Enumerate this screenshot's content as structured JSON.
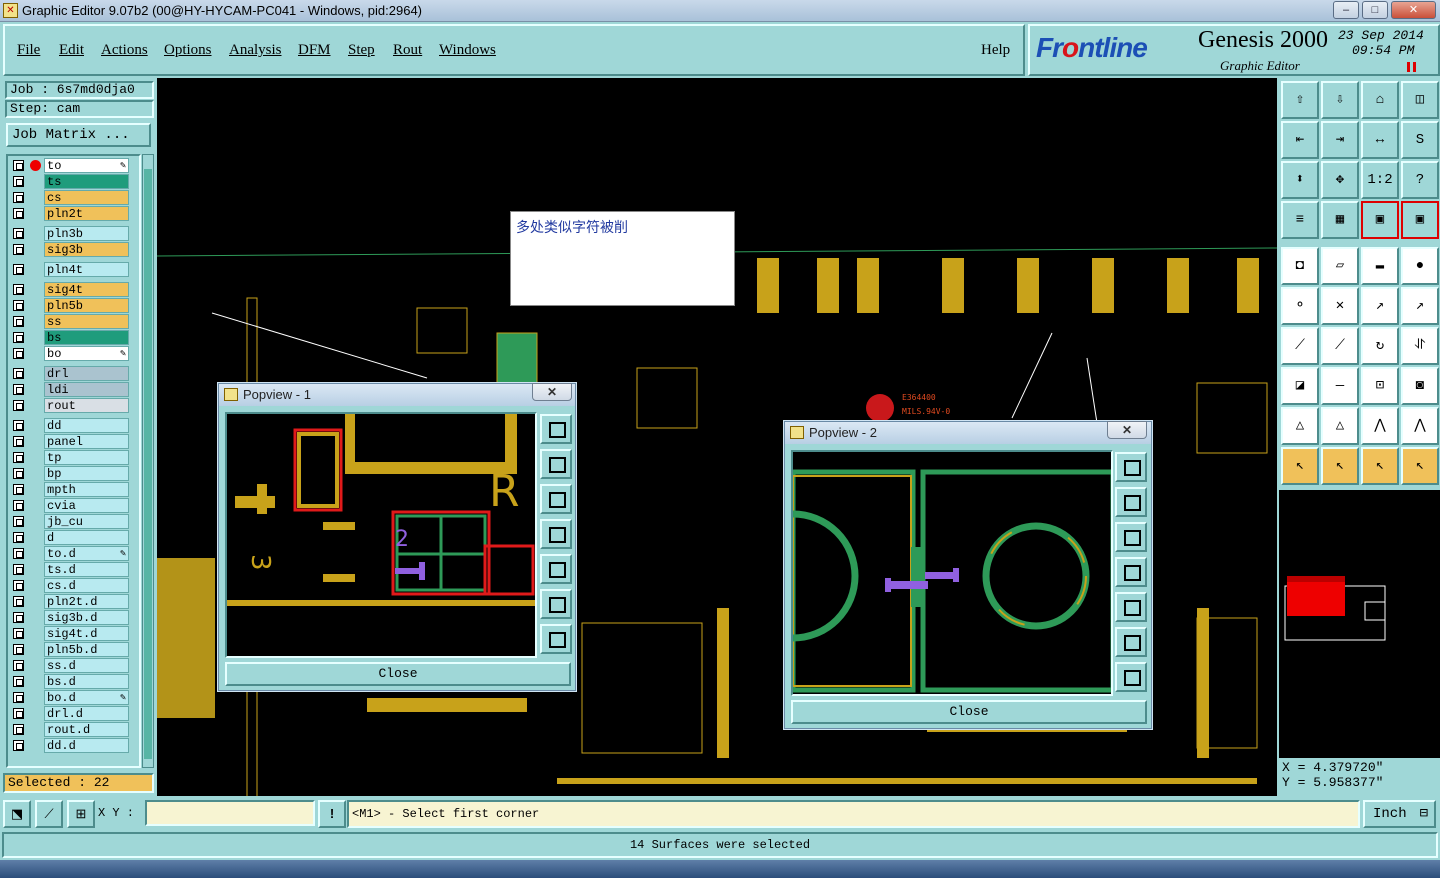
{
  "window": {
    "title": "Graphic Editor 9.07b2 (00@HY-HYCAM-PC041 - Windows, pid:2964)",
    "minimize": "–",
    "maximize": "□",
    "close": "✕"
  },
  "menu": [
    "File",
    "Edit",
    "Actions",
    "Options",
    "Analysis",
    "DFM",
    "Step",
    "Rout",
    "Windows"
  ],
  "help": "Help",
  "brand": {
    "logo_a": "Fr",
    "logo_b": "o",
    "logo_c": "ntline",
    "product": "Genesis 2000",
    "subtitle": "Graphic Editor",
    "date": "23 Sep 2014",
    "time": "09:54 PM"
  },
  "job": {
    "job_label": "Job : 6s7md0dja0",
    "step_label": "Step: cam",
    "matrix_button": "Job Matrix ..."
  },
  "layers": [
    {
      "name": "to",
      "color": "#ffffff",
      "dot": true,
      "pen": true
    },
    {
      "name": "ts",
      "color": "#1f9c7c"
    },
    {
      "name": "cs",
      "color": "#f0c15a"
    },
    {
      "name": "pln2t",
      "color": "#f0c15a"
    },
    {
      "name": "pln3b",
      "color": "#b8eaf0"
    },
    {
      "name": "sig3b",
      "color": "#f0c15a"
    },
    {
      "name": "pln4t",
      "color": "#b8eaf0"
    },
    {
      "name": "sig4t",
      "color": "#f0c15a"
    },
    {
      "name": "pln5b",
      "color": "#f0c15a"
    },
    {
      "name": "ss",
      "color": "#f0c15a"
    },
    {
      "name": "bs",
      "color": "#1f9c7c"
    },
    {
      "name": "bo",
      "color": "#ffffff",
      "pen": true
    },
    {
      "name": "drl",
      "color": "#aac3cf"
    },
    {
      "name": "ldi",
      "color": "#aac3cf"
    },
    {
      "name": "rout",
      "color": "#d9dfe5"
    },
    {
      "name": "dd",
      "color": "#b8eaf0"
    },
    {
      "name": "panel",
      "color": "#b8eaf0"
    },
    {
      "name": "tp",
      "color": "#b8eaf0"
    },
    {
      "name": "bp",
      "color": "#b8eaf0"
    },
    {
      "name": "mpth",
      "color": "#b8eaf0"
    },
    {
      "name": "cvia",
      "color": "#b8eaf0"
    },
    {
      "name": "jb_cu",
      "color": "#b8eaf0"
    },
    {
      "name": "d",
      "color": "#b8eaf0"
    },
    {
      "name": "to.d",
      "color": "#b8eaf0",
      "pen": true
    },
    {
      "name": "ts.d",
      "color": "#b8eaf0"
    },
    {
      "name": "cs.d",
      "color": "#b8eaf0"
    },
    {
      "name": "pln2t.d",
      "color": "#b8eaf0"
    },
    {
      "name": "sig3b.d",
      "color": "#b8eaf0"
    },
    {
      "name": "sig4t.d",
      "color": "#b8eaf0"
    },
    {
      "name": "pln5b.d",
      "color": "#b8eaf0"
    },
    {
      "name": "ss.d",
      "color": "#b8eaf0"
    },
    {
      "name": "bs.d",
      "color": "#b8eaf0"
    },
    {
      "name": "bo.d",
      "color": "#b8eaf0",
      "pen": true
    },
    {
      "name": "drl.d",
      "color": "#b8eaf0"
    },
    {
      "name": "rout.d",
      "color": "#b8eaf0"
    },
    {
      "name": "dd.d",
      "color": "#b8eaf0"
    }
  ],
  "selected": "Selected : 22",
  "note": "多处类似字符被削",
  "board_marking": {
    "line1": "E364400",
    "line2": "MILS.94V-0"
  },
  "popview1": {
    "title": "Popview - 1",
    "close": "Close",
    "x_button": "✕"
  },
  "popview2": {
    "title": "Popview - 2",
    "close": "Close",
    "x_button": "✕"
  },
  "tools": [
    [
      "⇧",
      "⇩",
      "⌂",
      "◫"
    ],
    [
      "⇤",
      "⇥",
      "↔",
      "S"
    ],
    [
      "⬍",
      "✥",
      "1:2",
      "?"
    ],
    [
      "≡",
      "▦",
      "▣",
      "▣"
    ],
    [
      "◘",
      "▱",
      "▬",
      "●"
    ],
    [
      "⚬",
      "✕",
      "↗",
      "↗"
    ],
    [
      "⟋",
      "⟋",
      "↻",
      "⥯"
    ],
    [
      "◪",
      "—",
      "⊡",
      "◙"
    ],
    [
      "△",
      "△",
      "⋀",
      "⋀"
    ],
    [
      "↖",
      "↖",
      "↖",
      "↖"
    ]
  ],
  "coords": {
    "x": "X = 4.379720\"",
    "y": "Y = 5.958377\""
  },
  "statusbar": {
    "xy_label": "X Y :",
    "xy_value": "",
    "prompt": "<M1> - Select first corner",
    "unit": "Inch",
    "message": "14 Surfaces were selected",
    "alert": "!"
  }
}
